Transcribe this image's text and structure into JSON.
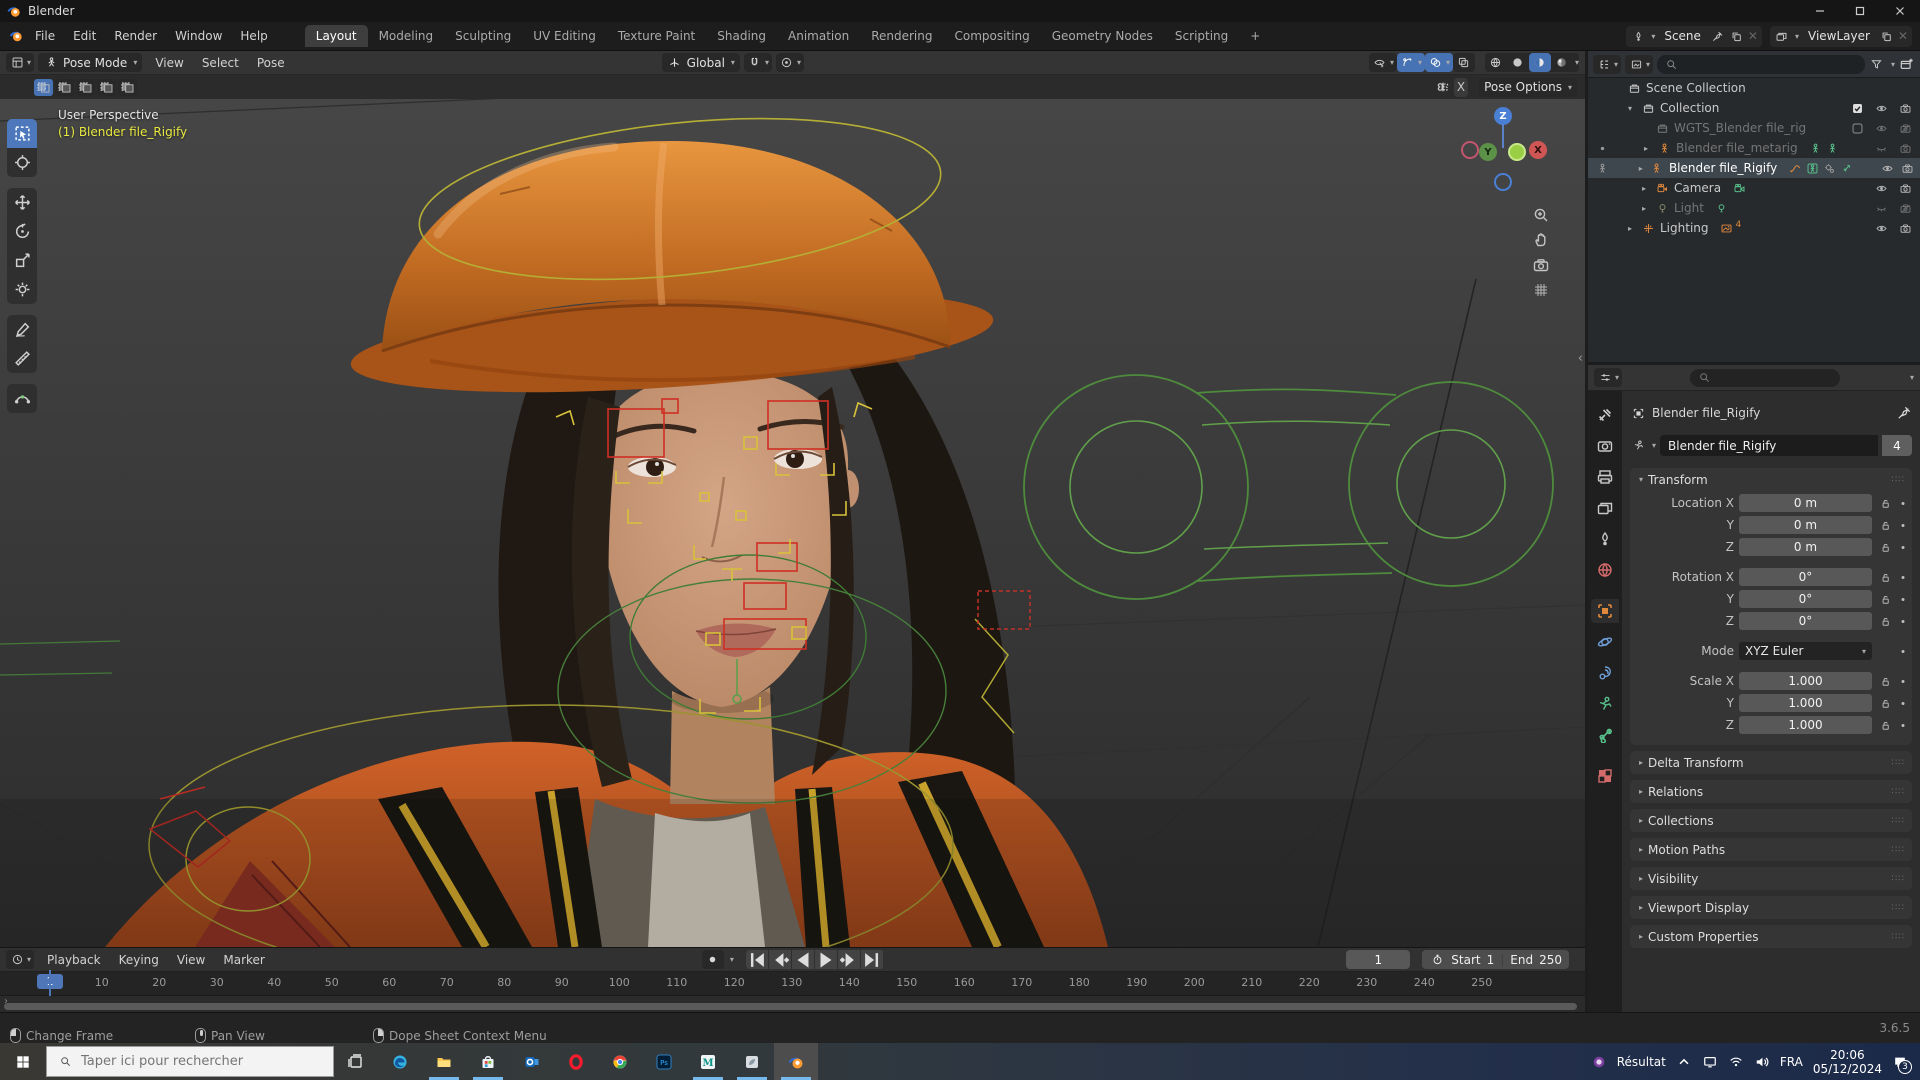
{
  "titlebar": {
    "app": "Blender"
  },
  "menubar": {
    "menus": [
      "File",
      "Edit",
      "Render",
      "Window",
      "Help"
    ],
    "tabs": [
      "Layout",
      "Modeling",
      "Sculpting",
      "UV Editing",
      "Texture Paint",
      "Shading",
      "Animation",
      "Rendering",
      "Compositing",
      "Geometry Nodes",
      "Scripting",
      "+"
    ],
    "active_tab": "Layout",
    "scene": "Scene",
    "viewlayer": "ViewLayer"
  },
  "viewport": {
    "mode": "Pose Mode",
    "menus": [
      "View",
      "Select",
      "Pose"
    ],
    "orientation": "Global",
    "mirror_x": "X",
    "pose_options": "Pose Options",
    "overlay_perspective": "User Perspective",
    "overlay_active_object": "(1) Blender file_Rigify",
    "gizmo": {
      "x": "X",
      "y": "Y",
      "z": "Z"
    },
    "header_toggles": [
      {
        "icon": "vis-eye",
        "active": false,
        "caret": true
      },
      {
        "icon": "gizmo-icon",
        "active": true,
        "caret": true
      },
      {
        "icon": "overlays-icon",
        "active": true,
        "caret": true
      },
      {
        "icon": "xray-icon",
        "active": false,
        "caret": false
      }
    ],
    "shading_modes": [
      {
        "icon": "shading-wireframe",
        "active": false
      },
      {
        "icon": "shading-solid",
        "active": false
      },
      {
        "icon": "shading-material",
        "active": true
      },
      {
        "icon": "shading-rendered",
        "active": false
      }
    ],
    "toolbar": [
      {
        "name": "tool-select-box",
        "icon": "select-box-icon",
        "active": true,
        "group": 0
      },
      {
        "name": "tool-cursor",
        "icon": "cursor-icon",
        "active": false,
        "group": 0
      },
      {
        "name": "tool-move",
        "icon": "move-icon",
        "active": false,
        "group": 1
      },
      {
        "name": "tool-rotate",
        "icon": "rotate-icon",
        "active": false,
        "group": 1
      },
      {
        "name": "tool-scale",
        "icon": "scale-icon",
        "active": false,
        "group": 1
      },
      {
        "name": "tool-transform",
        "icon": "transform-icon",
        "active": false,
        "group": 1
      },
      {
        "name": "tool-annotate",
        "icon": "annotate-icon",
        "active": false,
        "group": 2
      },
      {
        "name": "tool-measure",
        "icon": "measure-icon",
        "active": false,
        "group": 2
      },
      {
        "name": "tool-breakdowner",
        "icon": "breakdowner-icon",
        "active": false,
        "group": 3
      }
    ]
  },
  "outliner": {
    "rows": [
      {
        "name": "scene-collection",
        "icon": "collection",
        "color": "#c9c9c9",
        "label": "Scene Collection",
        "level": 0,
        "arrow": "",
        "gutter": "",
        "dim": false,
        "selected": false,
        "badges": [],
        "controls": [
          "",
          "",
          ""
        ]
      },
      {
        "name": "collection",
        "icon": "collection",
        "color": "#c9c9c9",
        "label": "Collection",
        "level": 1,
        "arrow": "down",
        "gutter": "",
        "dim": false,
        "selected": false,
        "badges": [],
        "controls": [
          "checkbox-on",
          "eye",
          "camera"
        ]
      },
      {
        "name": "wgts-rig",
        "icon": "collection",
        "color": "#7a7a7a",
        "label": "WGTS_Blender file_rig",
        "level": 2,
        "arrow": "",
        "gutter": "",
        "dim": true,
        "selected": false,
        "badges": [],
        "controls": [
          "checkbox-off",
          "eye",
          "camera-off"
        ]
      },
      {
        "name": "metarig",
        "icon": "armature",
        "color": "#e0883c",
        "label": "Blender file_metarig",
        "level": 2,
        "arrow": "right",
        "gutter": "dot",
        "dim": true,
        "selected": false,
        "badges": [
          {
            "icon": "pose-badge",
            "color": "#58c08a"
          },
          {
            "icon": "pose-badge",
            "color": "#58c08a"
          }
        ],
        "controls": [
          "",
          "eye-closed",
          "camera"
        ]
      },
      {
        "name": "rigify",
        "icon": "armature",
        "color": "#e0883c",
        "label": "Blender file_Rigify",
        "level": 2,
        "arrow": "right",
        "gutter": "pose-badge",
        "dim": false,
        "selected": true,
        "badges": [
          {
            "icon": "curve-badge",
            "color": "#e0883c"
          },
          {
            "icon": "pose-box-badge",
            "color": "#58c08a"
          },
          {
            "icon": "tools-badge",
            "color": "#9a9a9a"
          },
          {
            "icon": "bone-badge",
            "color": "#58c08a"
          }
        ],
        "controls": [
          "",
          "eye",
          "camera"
        ]
      },
      {
        "name": "camera",
        "icon": "camera-object",
        "color": "#e0883c",
        "label": "Camera",
        "level": 2,
        "arrow": "right",
        "gutter": "",
        "dim": false,
        "selected": false,
        "badges": [
          {
            "icon": "camera-data-badge",
            "color": "#58c08a"
          }
        ],
        "controls": [
          "",
          "eye",
          "camera"
        ]
      },
      {
        "name": "light",
        "icon": "light",
        "color": "#8a8a6a",
        "label": "Light",
        "level": 2,
        "arrow": "right",
        "gutter": "",
        "dim": true,
        "selected": false,
        "badges": [
          {
            "icon": "light-data-badge",
            "color": "#58c08a"
          }
        ],
        "controls": [
          "",
          "eye-closed",
          "camera-off"
        ]
      },
      {
        "name": "lighting",
        "icon": "empty-axis",
        "color": "#e0883c",
        "label": "Lighting",
        "level": 1,
        "arrow": "right",
        "gutter": "",
        "dim": false,
        "selected": false,
        "badges": [
          {
            "icon": "image-badge",
            "color": "#e0883c",
            "count": "4"
          }
        ],
        "controls": [
          "",
          "eye",
          "camera"
        ]
      }
    ]
  },
  "properties": {
    "tabs": [
      {
        "name": "tab-tool",
        "icon": "tool-tab",
        "color": "#c9c9c9",
        "active": false,
        "gap": false
      },
      {
        "name": "tab-render",
        "icon": "render-tab",
        "color": "#c9c9c9",
        "active": false,
        "gap": false
      },
      {
        "name": "tab-output",
        "icon": "output-tab",
        "color": "#c9c9c9",
        "active": false,
        "gap": false
      },
      {
        "name": "tab-viewlayer",
        "icon": "viewlayer-tab",
        "color": "#c9c9c9",
        "active": false,
        "gap": false
      },
      {
        "name": "tab-scene",
        "icon": "scene-tab",
        "color": "#c9c9c9",
        "active": false,
        "gap": false
      },
      {
        "name": "tab-world",
        "icon": "world-tab",
        "color": "#d46a6a",
        "active": false,
        "gap": false
      },
      {
        "name": "tab-object",
        "icon": "object-tab",
        "color": "#e0883c",
        "active": true,
        "gap": true
      },
      {
        "name": "tab-physics",
        "icon": "physics-tab",
        "color": "#6f9fd8",
        "active": false,
        "gap": false
      },
      {
        "name": "tab-constraints",
        "icon": "constraints-tab",
        "color": "#6f9fd8",
        "active": false,
        "gap": false
      },
      {
        "name": "tab-data",
        "icon": "data-tab",
        "color": "#58c08a",
        "active": false,
        "gap": false
      },
      {
        "name": "tab-bone",
        "icon": "bone-tab",
        "color": "#58c08a",
        "active": false,
        "gap": false
      },
      {
        "name": "tab-texture",
        "icon": "texture-tab",
        "color": "#d46a6a",
        "active": false,
        "gap": true
      }
    ],
    "breadcrumb": "Blender file_Rigify",
    "object_name": "Blender file_Rigify",
    "users_count": "4",
    "transform_title": "Transform",
    "transform_rows": [
      {
        "label": "Location X",
        "value": "0 m",
        "lock": true,
        "drop": false,
        "gap": false
      },
      {
        "label": "Y",
        "value": "0 m",
        "lock": true,
        "drop": false,
        "gap": false
      },
      {
        "label": "Z",
        "value": "0 m",
        "lock": true,
        "drop": false,
        "gap": false
      },
      {
        "label": "Rotation X",
        "value": "0°",
        "lock": true,
        "drop": false,
        "gap": true
      },
      {
        "label": "Y",
        "value": "0°",
        "lock": true,
        "drop": false,
        "gap": false
      },
      {
        "label": "Z",
        "value": "0°",
        "lock": true,
        "drop": false,
        "gap": false
      },
      {
        "label": "Mode",
        "value": "XYZ Euler",
        "lock": false,
        "drop": true,
        "gap": true
      },
      {
        "label": "Scale X",
        "value": "1.000",
        "lock": true,
        "drop": false,
        "gap": true
      },
      {
        "label": "Y",
        "value": "1.000",
        "lock": true,
        "drop": false,
        "gap": false
      },
      {
        "label": "Z",
        "value": "1.000",
        "lock": true,
        "drop": false,
        "gap": false
      }
    ],
    "panels": [
      "Delta Transform",
      "Relations",
      "Collections",
      "Motion Paths",
      "Visibility",
      "Viewport Display",
      "Custom Properties"
    ]
  },
  "timeline": {
    "menus": [
      "Playback",
      "Keying",
      "View",
      "Marker"
    ],
    "current_frame": "1",
    "start_label": "Start",
    "start_value": "1",
    "end_label": "End",
    "end_value": "250",
    "ticks": [
      1,
      10,
      20,
      30,
      40,
      50,
      60,
      70,
      80,
      90,
      100,
      110,
      120,
      130,
      140,
      150,
      160,
      170,
      180,
      190,
      200,
      210,
      220,
      230,
      240,
      250
    ],
    "transport": [
      "jump-start",
      "prev-keyframe",
      "play-reverse",
      "play",
      "next-keyframe",
      "jump-end"
    ]
  },
  "statusbar": {
    "hints": [
      {
        "button": "l",
        "label": "Change Frame"
      },
      {
        "button": "m",
        "label": "Pan View"
      },
      {
        "button": "r",
        "label": "Dope Sheet Context Menu"
      }
    ],
    "version": "3.6.5"
  },
  "taskbar": {
    "search_placeholder": "Taper ici pour rechercher",
    "apps": [
      {
        "name": "task-view",
        "icon": "taskview-icon",
        "underline": false,
        "active": false
      },
      {
        "name": "edge",
        "icon": "edge-icon",
        "underline": false,
        "active": false
      },
      {
        "name": "explorer",
        "icon": "explorer-icon",
        "underline": true,
        "active": false
      },
      {
        "name": "store",
        "icon": "store-icon",
        "underline": true,
        "active": false
      },
      {
        "name": "outlook",
        "icon": "outlook-icon",
        "underline": false,
        "active": false
      },
      {
        "name": "opera",
        "icon": "opera-icon",
        "underline": false,
        "active": false
      },
      {
        "name": "chrome",
        "icon": "chrome-icon",
        "underline": false,
        "active": false
      },
      {
        "name": "photoshop",
        "icon": "photoshop-icon",
        "underline": false,
        "active": false
      },
      {
        "name": "maya",
        "icon": "maya-icon",
        "underline": true,
        "active": false
      },
      {
        "name": "paint",
        "icon": "paint-icon",
        "underline": true,
        "active": false
      },
      {
        "name": "blender",
        "icon": "blender-icon",
        "underline": true,
        "active": true
      }
    ],
    "tray": {
      "widget": "Résultat",
      "lang": "FRA",
      "time": "20:06",
      "date": "05/12/2024",
      "badge": "3"
    }
  }
}
